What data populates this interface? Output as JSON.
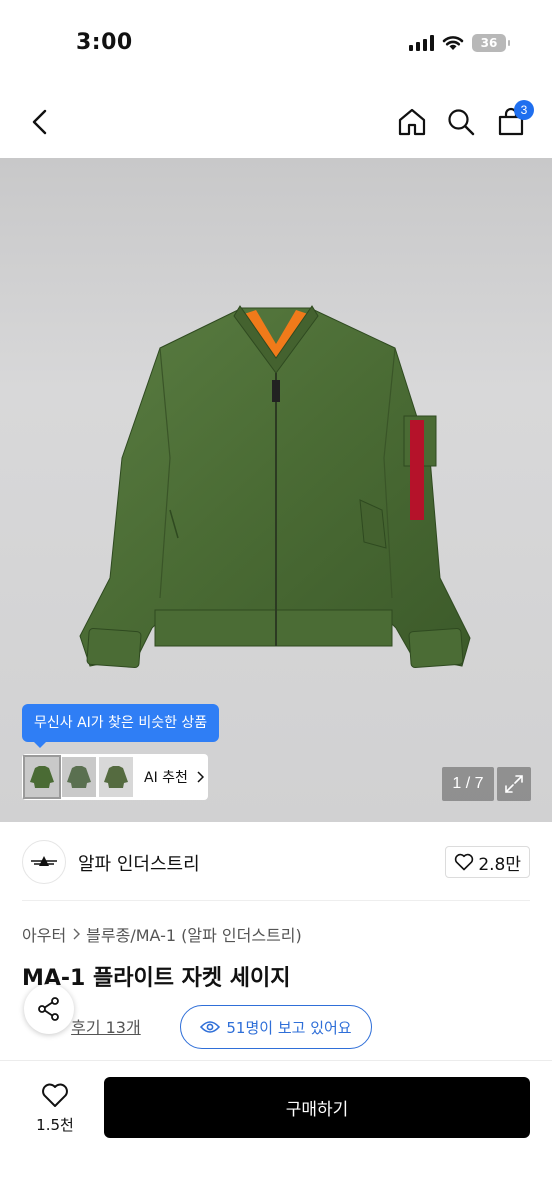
{
  "status_bar": {
    "time": "3:00",
    "battery": "36"
  },
  "nav": {
    "cart_count": "3"
  },
  "gallery": {
    "ai_tooltip": "무신사 AI가 찾은 비슷한 상품",
    "ai_recommend_label": "AI 추천",
    "page_indicator": "1 / 7",
    "product_color": "#4a6b34",
    "lining_color": "#f07a1a"
  },
  "brand": {
    "name": "알파 인더스트리",
    "likes": "2.8만"
  },
  "breadcrumb": {
    "category": "아우터",
    "subcategory": "블루종/MA-1 (알파 인더스트리)"
  },
  "product": {
    "title": "MA-1 플라이트 자켓 세이지",
    "review_label": "후기 13개",
    "viewers": "51명이 보고 있어요"
  },
  "bottom": {
    "wish_count": "1.5천",
    "buy_label": "구매하기"
  }
}
